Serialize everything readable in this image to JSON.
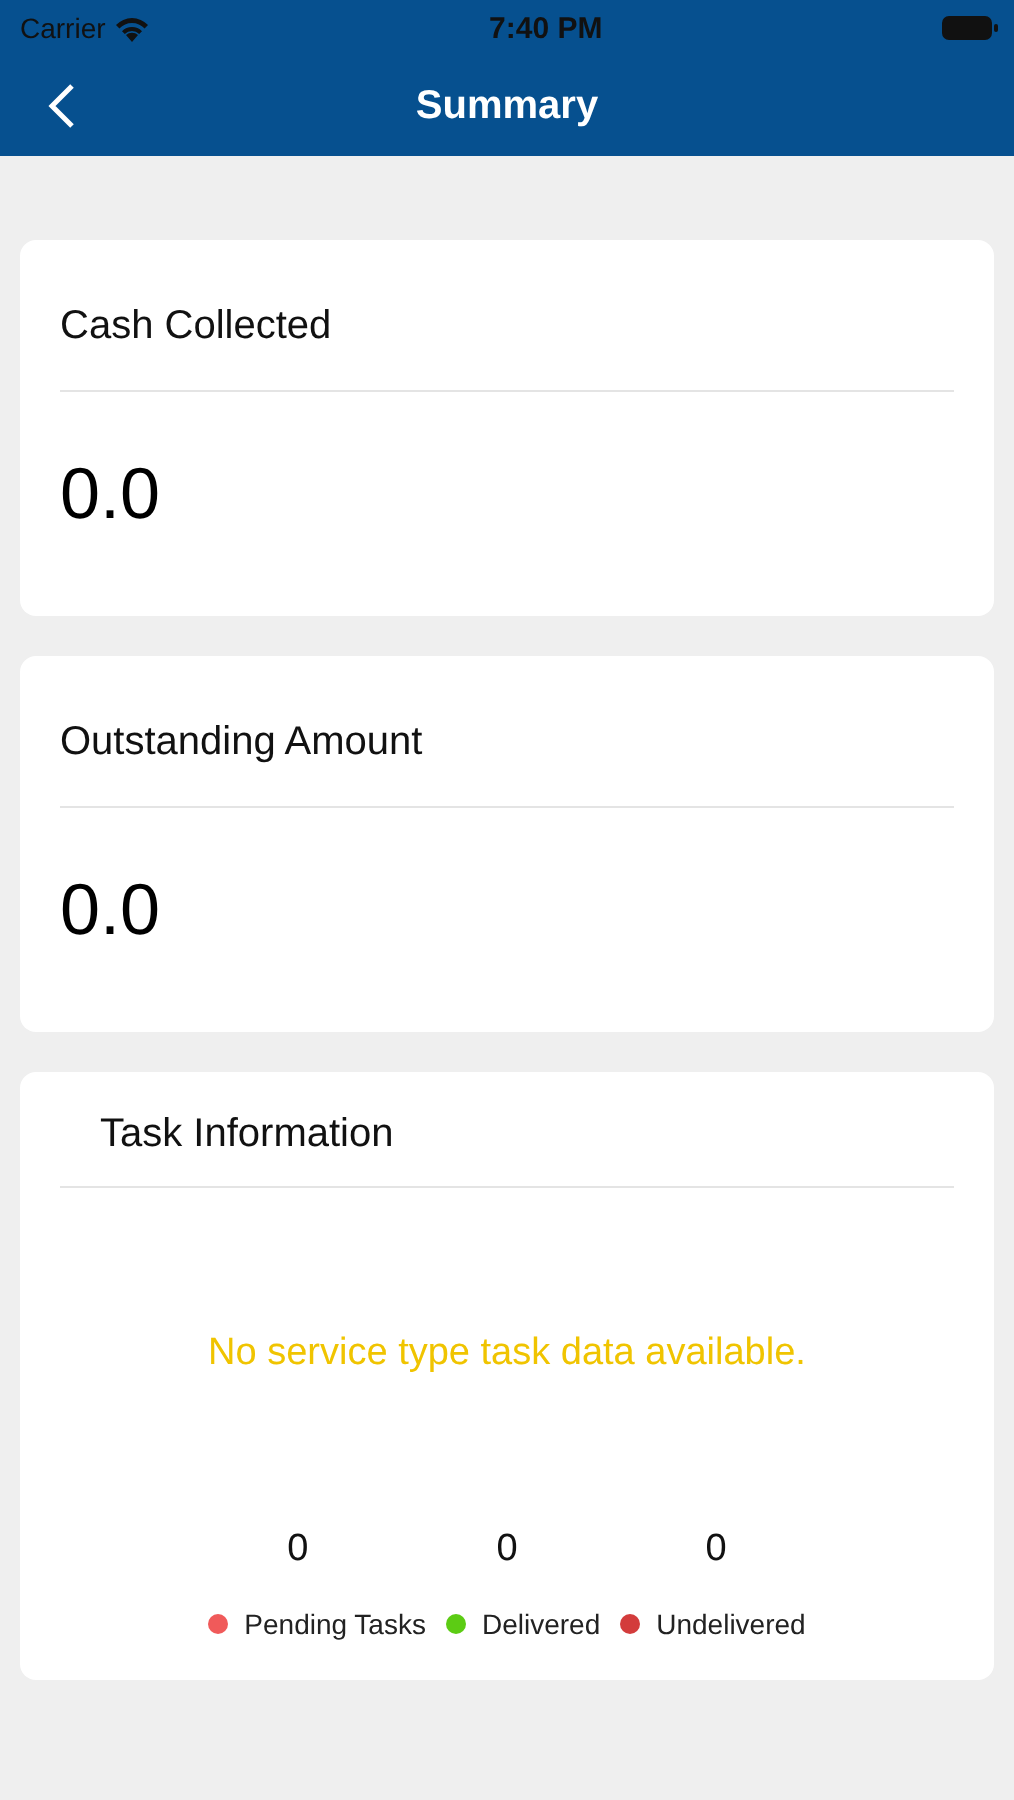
{
  "status_bar": {
    "carrier": "Carrier",
    "time": "7:40 PM"
  },
  "nav": {
    "title": "Summary"
  },
  "cards": [
    {
      "title": "Cash Collected",
      "value": "0.0"
    },
    {
      "title": "Outstanding Amount",
      "value": "0.0"
    }
  ],
  "task_info": {
    "title": "Task Information",
    "message": "No service type task data available.",
    "counts": [
      "0",
      "0",
      "0"
    ],
    "legend": [
      {
        "label": "Pending Tasks",
        "color": "#f05a5a"
      },
      {
        "label": "Delivered",
        "color": "#5ccc14"
      },
      {
        "label": "Undelivered",
        "color": "#d33c3c"
      }
    ]
  }
}
